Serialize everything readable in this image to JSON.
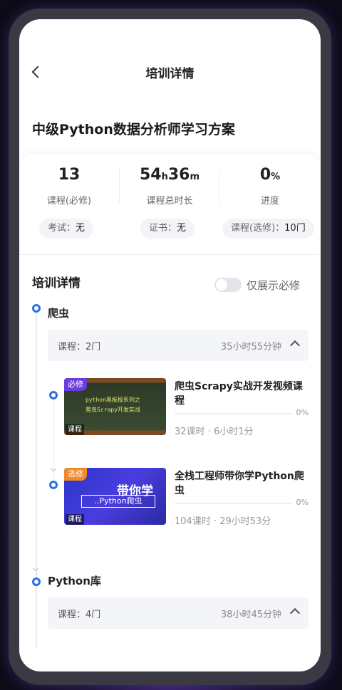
{
  "nav": {
    "title": "培训详情"
  },
  "plan_title": "中级Python数据分析师学习方案",
  "summary": {
    "courses_num": "13",
    "courses_label": "课程(必修)",
    "hours_h": "54",
    "hours_h_unit": "h",
    "hours_m": "36",
    "hours_m_unit": "m",
    "hours_label": "课程总时长",
    "progress_num": "0",
    "progress_unit": "%",
    "progress_label": "进度",
    "exam_label": "考试：",
    "exam_value": "无",
    "cert_label": "证书：",
    "cert_value": "无",
    "elective_label": "课程(选修)：",
    "elective_value": "10门"
  },
  "details": {
    "title": "培训详情",
    "toggle_label": "仅展示必修",
    "toggle_on": false
  },
  "groups": [
    {
      "name": "爬虫",
      "count": "课程：2门",
      "duration": "35小时55分钟",
      "courses": [
        {
          "tag": "必修",
          "tag_color": "#6a3de0",
          "type": "课程",
          "title": "爬虫Scrapy实战开发视频课程",
          "progress": 0,
          "progress_text": "0%",
          "meta": "32课时 · 6小时1分",
          "thumb_text_1": "python黑板报系列之",
          "thumb_text_2": "爬虫Scrapy开发实战"
        },
        {
          "tag": "选修",
          "tag_color": "#f08a2a",
          "type": "课程",
          "title": "全栈工程师带你学Python爬虫",
          "progress": 0,
          "progress_text": "0%",
          "meta": "104课时 · 29小时53分",
          "thumb_text_1": "带你学",
          "thumb_text_2": "..Python爬虫"
        }
      ]
    },
    {
      "name": "Python库",
      "count": "课程：4门",
      "duration": "38小时45分钟",
      "courses": []
    }
  ]
}
